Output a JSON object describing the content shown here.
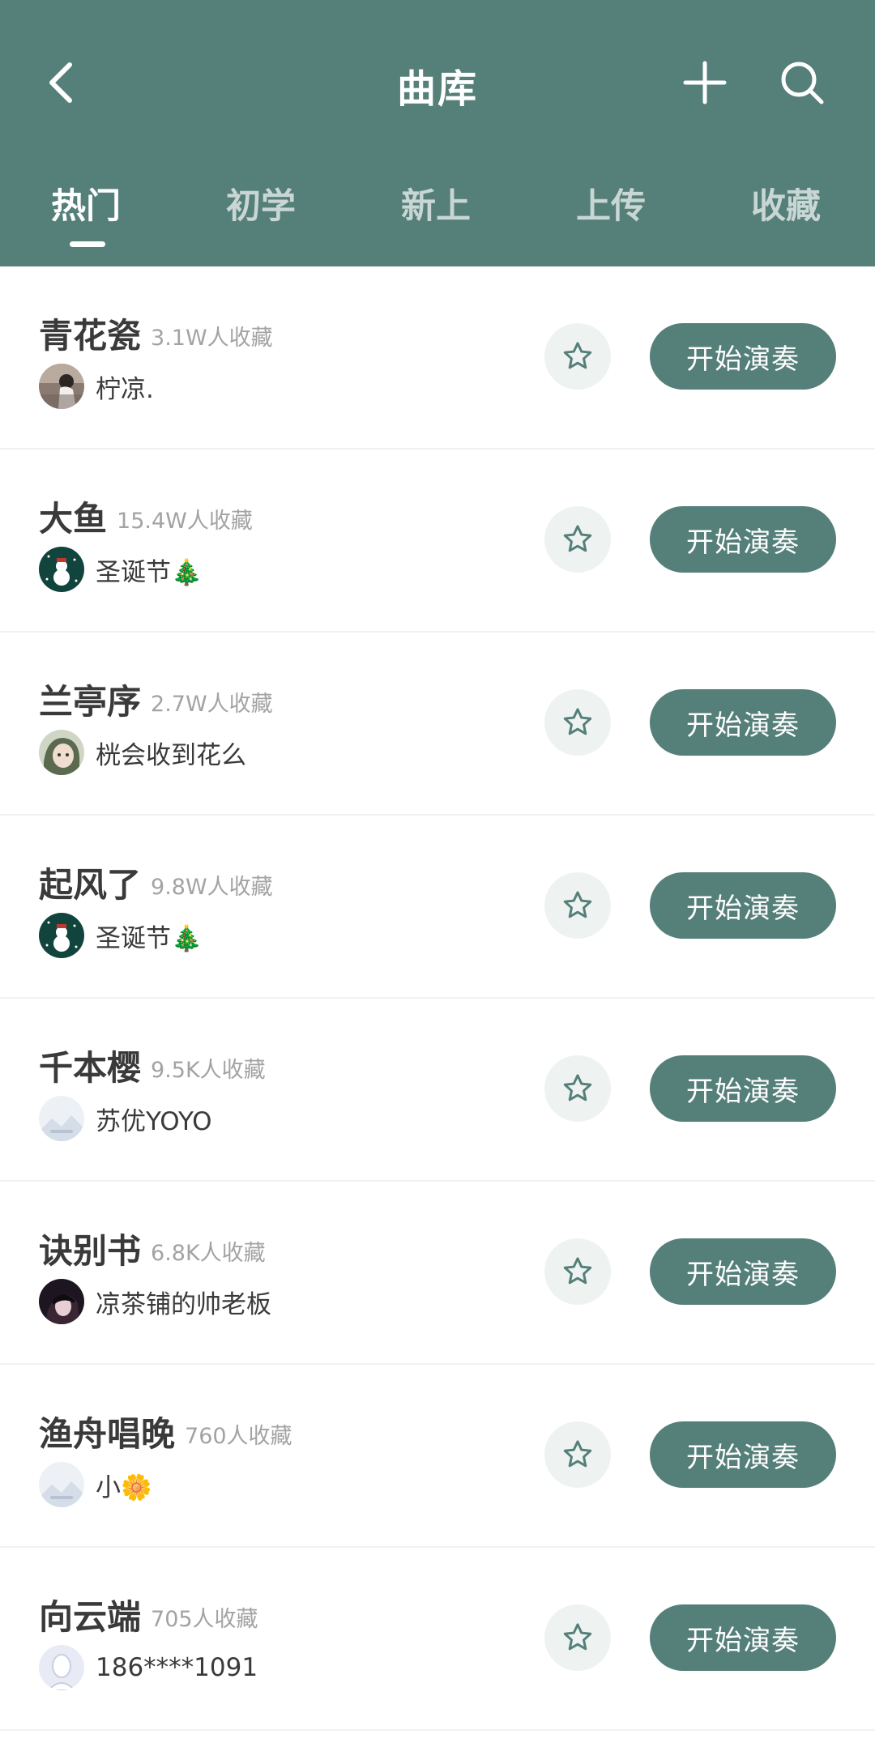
{
  "header": {
    "title": "曲库",
    "bg_color": "#557f79",
    "icons": {
      "back": "chevron-left-icon",
      "add": "plus-icon",
      "search": "search-icon"
    }
  },
  "tabs": [
    {
      "label": "热门",
      "active": true
    },
    {
      "label": "初学",
      "active": false
    },
    {
      "label": "新上",
      "active": false
    },
    {
      "label": "上传",
      "active": false
    },
    {
      "label": "收藏",
      "active": false
    }
  ],
  "play_label": "开始演奏",
  "songs": [
    {
      "title": "青花瓷",
      "count": "3.1W人收藏",
      "uploader": "柠凉.",
      "avatar": "photo-girl"
    },
    {
      "title": "大鱼",
      "count": "15.4W人收藏",
      "uploader": "圣诞节🎄",
      "avatar": "snowman"
    },
    {
      "title": "兰亭序",
      "count": "2.7W人收藏",
      "uploader": "桄会收到花么",
      "avatar": "anime-girl"
    },
    {
      "title": "起风了",
      "count": "9.8W人收藏",
      "uploader": "圣诞节🎄",
      "avatar": "snowman"
    },
    {
      "title": "千本樱",
      "count": "9.5K人收藏",
      "uploader": "苏优YOYO",
      "avatar": "default-landscape"
    },
    {
      "title": "诀别书",
      "count": "6.8K人收藏",
      "uploader": "凉茶铺的帅老板",
      "avatar": "dark-portrait"
    },
    {
      "title": "渔舟唱晚",
      "count": "760人收藏",
      "uploader": "小🌼",
      "avatar": "default-landscape"
    },
    {
      "title": "向云端",
      "count": "705人收藏",
      "uploader": "186****1091",
      "avatar": "default-person"
    }
  ]
}
